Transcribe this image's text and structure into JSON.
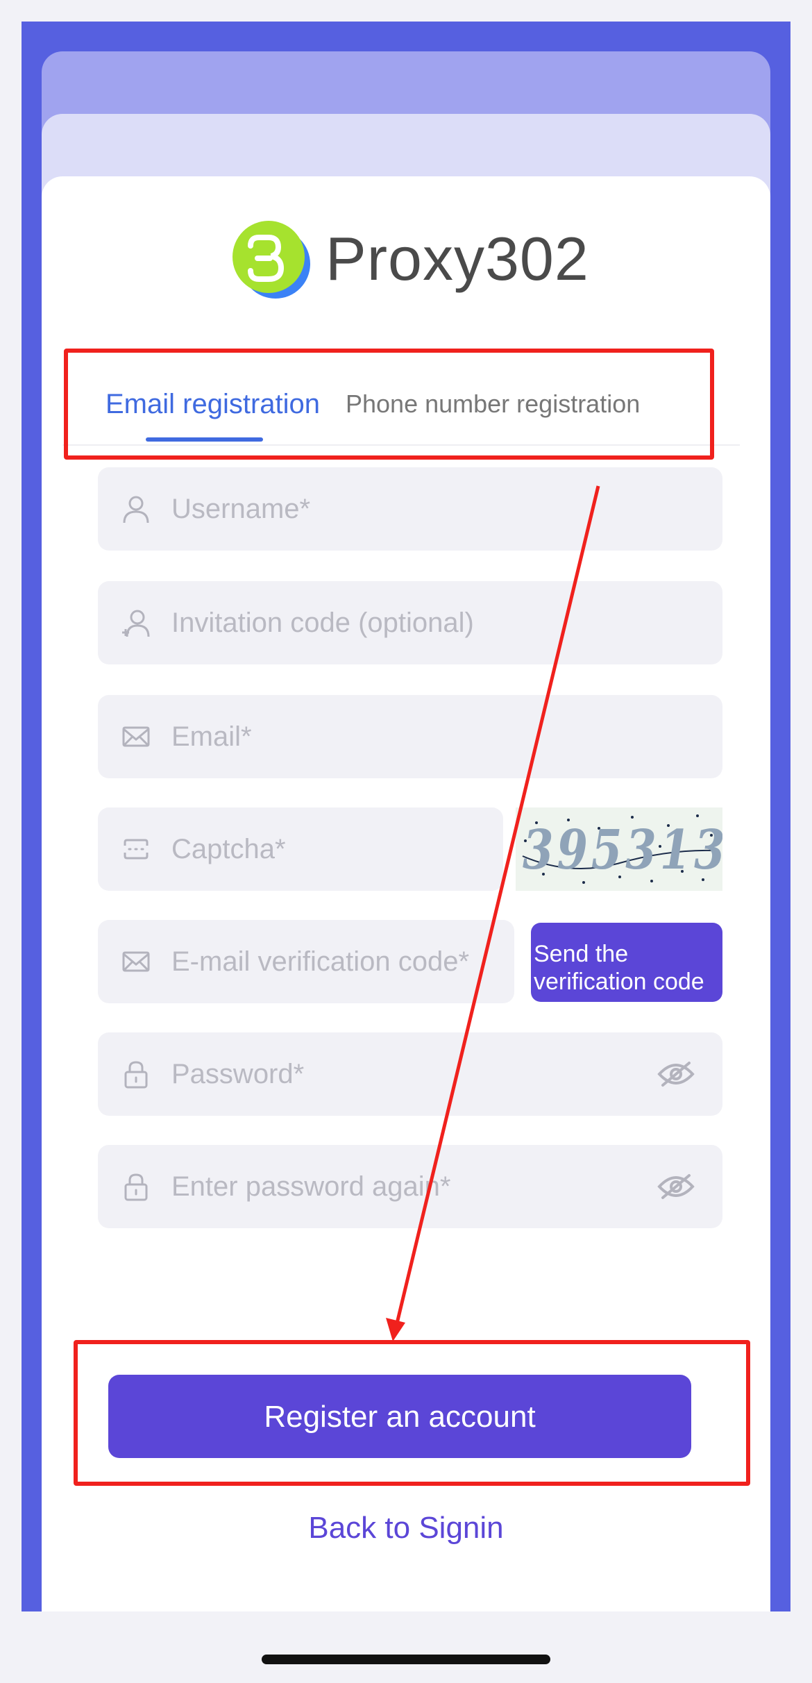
{
  "brand": {
    "name": "Proxy302",
    "logo_color": "#a6e22e",
    "logo_shadow_color": "#3b82f6"
  },
  "tabs": [
    {
      "label": "Email registration",
      "active": true
    },
    {
      "label": "Phone number registration",
      "active": false
    }
  ],
  "form": {
    "username_placeholder": "Username*",
    "invitation_placeholder": "Invitation code (optional)",
    "email_placeholder": "Email*",
    "captcha_placeholder": "Captcha*",
    "captcha_image_text": "395313",
    "email_code_placeholder": "E-mail verification code*",
    "send_code_label": "Send the\nverification code",
    "password_placeholder": "Password*",
    "password_confirm_placeholder": "Enter password again*"
  },
  "actions": {
    "register_label": "Register an account",
    "back_label": "Back to Signin"
  },
  "colors": {
    "accent": "#5b46d7",
    "tab_active": "#3f6ae0",
    "frame": "#5660e0",
    "annotation": "#f0211d"
  }
}
